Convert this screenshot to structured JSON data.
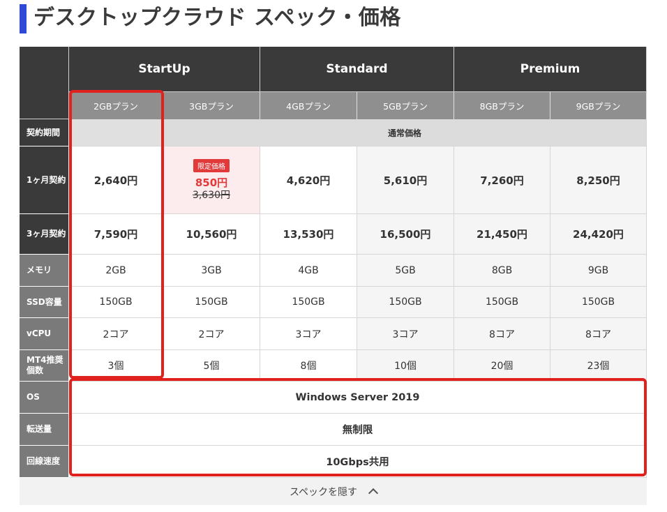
{
  "page_title": "デスクトップクラウド スペック・価格",
  "groups": [
    {
      "name": "StartUp"
    },
    {
      "name": "Standard"
    },
    {
      "name": "Premium"
    }
  ],
  "plans": [
    "2GBプラン",
    "3GBプラン",
    "4GBプラン",
    "5GBプラン",
    "8GBプラン",
    "9GBプラン"
  ],
  "row_headers": {
    "contract_period": "契約期間",
    "one_month": "1ヶ月契約",
    "three_month": "3ヶ月契約",
    "memory": "メモリ",
    "ssd": "SSD容量",
    "vcpu": "vCPU",
    "mt4": "MT4推奨個数",
    "os": "OS",
    "transfer": "転送量",
    "line_speed": "回線速度"
  },
  "contract_period_value": "通常価格",
  "one_month": {
    "p1": "2,640円",
    "p2_badge": "限定価格",
    "p2_sale": "850円",
    "p2_original": "3,630円",
    "p3": "4,620円",
    "p4": "5,610円",
    "p5": "7,260円",
    "p6": "8,250円"
  },
  "three_month": [
    "7,590円",
    "10,560円",
    "13,530円",
    "16,500円",
    "21,450円",
    "24,420円"
  ],
  "memory": [
    "2GB",
    "3GB",
    "4GB",
    "5GB",
    "8GB",
    "9GB"
  ],
  "ssd": [
    "150GB",
    "150GB",
    "150GB",
    "150GB",
    "150GB",
    "150GB"
  ],
  "vcpu": [
    "2コア",
    "2コア",
    "3コア",
    "3コア",
    "8コア",
    "8コア"
  ],
  "mt4": [
    "3個",
    "5個",
    "8個",
    "10個",
    "20個",
    "23個"
  ],
  "os": "Windows Server 2019",
  "transfer": "無制限",
  "line_speed": "10Gbps共用",
  "toggle_label": "スペックを隠す",
  "toggle_icon": "chevron-up-icon",
  "colors": {
    "accent_bar": "#2e49d6",
    "header_dark": "#3a3a3a",
    "plan_header": "#8f8f8f",
    "sale_red": "#e03a3a",
    "highlight_red": "#e0211d",
    "sale_bg": "#fdecee"
  }
}
